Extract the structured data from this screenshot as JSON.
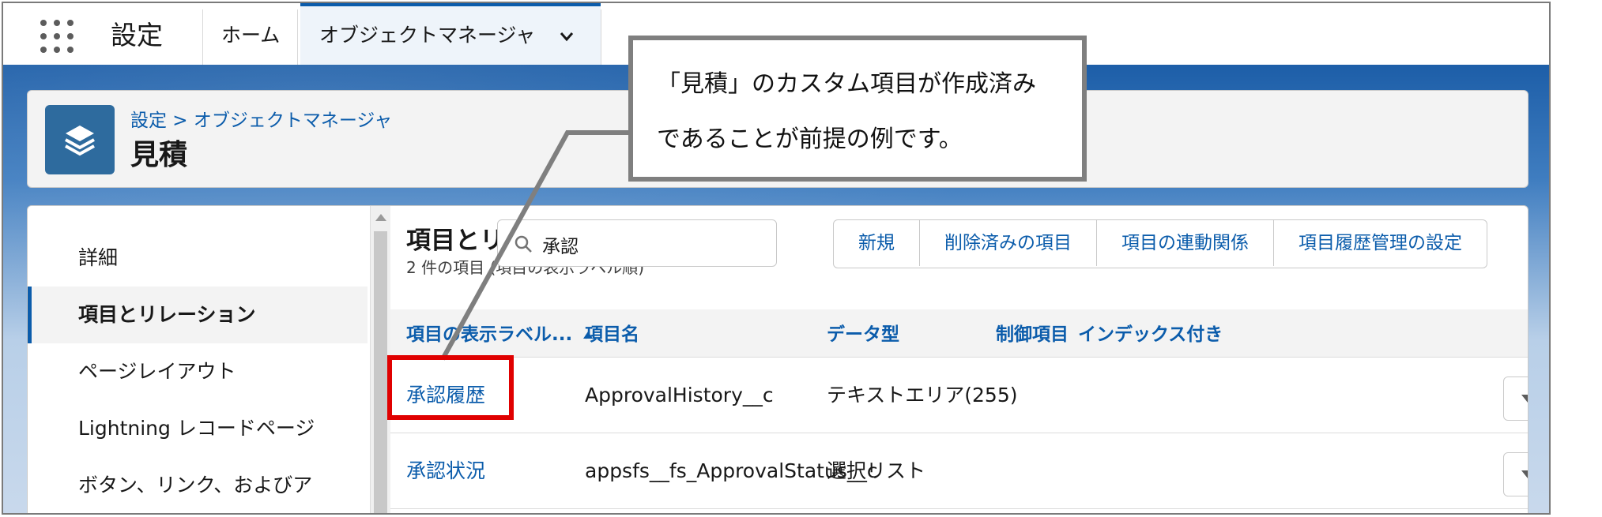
{
  "topbar": {
    "app_name": "設定",
    "tabs": [
      {
        "label": "ホーム"
      },
      {
        "label": "オブジェクトマネージャ"
      }
    ]
  },
  "header": {
    "breadcrumb": "設定 > オブジェクトマネージャ",
    "title": "見積"
  },
  "sidebar": {
    "items": [
      {
        "label": "詳細"
      },
      {
        "label": "項目とリレーション"
      },
      {
        "label": "ページレイアウト"
      },
      {
        "label": "Lightning レコードページ"
      },
      {
        "label": "ボタン、リンク、およびア"
      }
    ]
  },
  "main": {
    "section_title": "項目とリ",
    "section_sub": "2 件の項目 (項目の表示ラベル順)",
    "search": {
      "value": "承認"
    },
    "buttons": [
      "新規",
      "削除済みの項目",
      "項目の連動関係",
      "項目履歴管理の設定"
    ],
    "columns": [
      "項目の表示ラベル...",
      "項目名",
      "データ型",
      "制御項目",
      "インデックス付き"
    ],
    "rows": [
      {
        "label": "承認履歴",
        "api_name": "ApprovalHistory__c",
        "type": "テキストエリア(255)"
      },
      {
        "label": "承認状況",
        "api_name": "appsfs__fs_ApprovalStatus__c",
        "type": "選択リスト"
      }
    ]
  },
  "callout": {
    "line1": "「見積」のカスタム項目が作成済み",
    "line2": "であることが前提の例です。"
  },
  "colors": {
    "accent": "#0b5cab",
    "highlight": "#e00000",
    "brand_band": "#1b5aa3"
  }
}
